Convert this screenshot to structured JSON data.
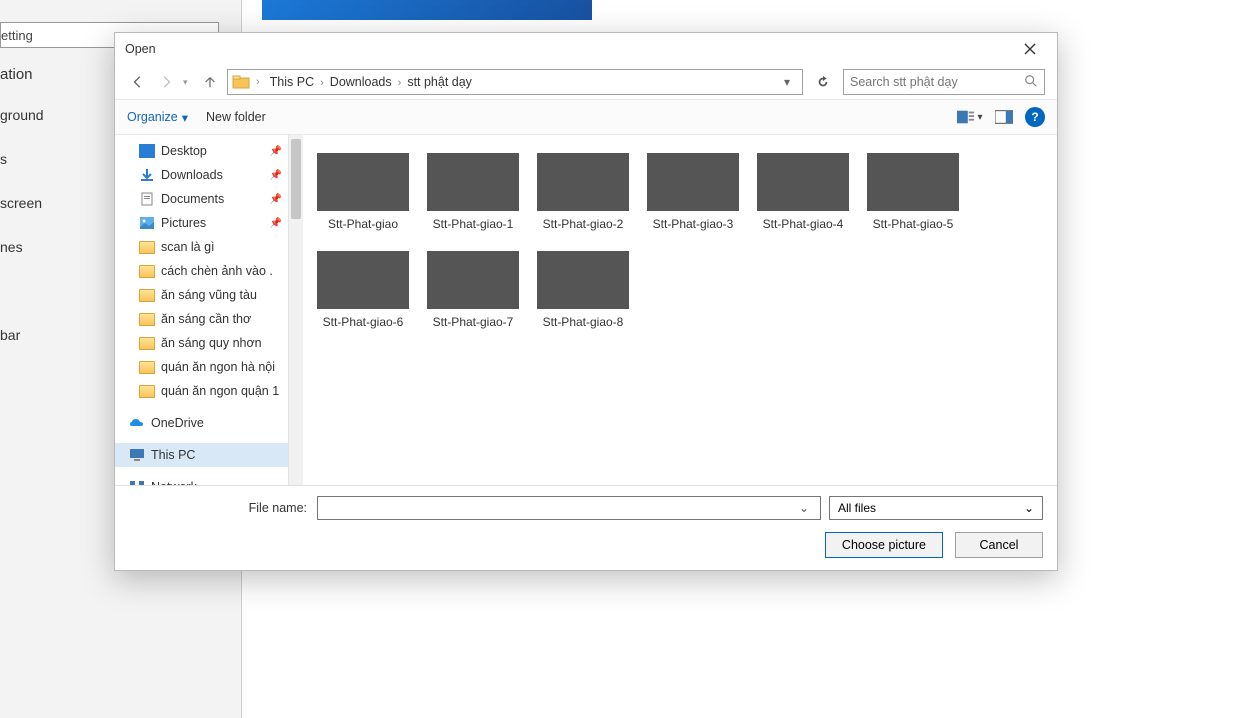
{
  "background_panel": {
    "search_text": "etting",
    "section_title": "ation",
    "items": [
      "ground",
      "s",
      "screen",
      "nes",
      "",
      "bar"
    ]
  },
  "dialog": {
    "title": "Open",
    "nav": {
      "breadcrumbs": [
        "This PC",
        "Downloads",
        "stt phật dạy"
      ],
      "search_placeholder": "Search stt phật dạy"
    },
    "toolbar": {
      "organize_label": "Organize",
      "new_folder_label": "New folder"
    },
    "sidebar": [
      {
        "label": "Desktop",
        "icon": "desktop",
        "pinned": true
      },
      {
        "label": "Downloads",
        "icon": "downloads",
        "pinned": true
      },
      {
        "label": "Documents",
        "icon": "documents",
        "pinned": true
      },
      {
        "label": "Pictures",
        "icon": "pictures",
        "pinned": true
      },
      {
        "label": "scan là gì",
        "icon": "folder"
      },
      {
        "label": "cách chèn ảnh vào .",
        "icon": "folder"
      },
      {
        "label": "ăn sáng vũng tàu",
        "icon": "folder"
      },
      {
        "label": "ăn sáng cần thơ",
        "icon": "folder"
      },
      {
        "label": "ăn sáng quy nhơn",
        "icon": "folder"
      },
      {
        "label": "quán ăn ngon hà nội",
        "icon": "folder"
      },
      {
        "label": "quán ăn ngon quận 1",
        "icon": "folder"
      },
      {
        "separator": true
      },
      {
        "label": "OneDrive",
        "icon": "onedrive",
        "group": true
      },
      {
        "separator": true
      },
      {
        "label": "This PC",
        "icon": "thispc",
        "group": true,
        "selected": true
      },
      {
        "separator": true
      },
      {
        "label": "Network",
        "icon": "network",
        "group": true
      }
    ],
    "files": [
      {
        "name": "Stt-Phat-giao",
        "thumb_class": "t0"
      },
      {
        "name": "Stt-Phat-giao-1",
        "thumb_class": "t1"
      },
      {
        "name": "Stt-Phat-giao-2",
        "thumb_class": "t2"
      },
      {
        "name": "Stt-Phat-giao-3",
        "thumb_class": "t3"
      },
      {
        "name": "Stt-Phat-giao-4",
        "thumb_class": "t4"
      },
      {
        "name": "Stt-Phat-giao-5",
        "thumb_class": "t5"
      },
      {
        "name": "Stt-Phat-giao-6",
        "thumb_class": "t6"
      },
      {
        "name": "Stt-Phat-giao-7",
        "thumb_class": "t7"
      },
      {
        "name": "Stt-Phat-giao-8",
        "thumb_class": "t8"
      }
    ],
    "footer": {
      "file_name_label": "File name:",
      "file_name_value": "",
      "filter_label": "All files",
      "choose_label": "Choose picture",
      "cancel_label": "Cancel"
    }
  }
}
